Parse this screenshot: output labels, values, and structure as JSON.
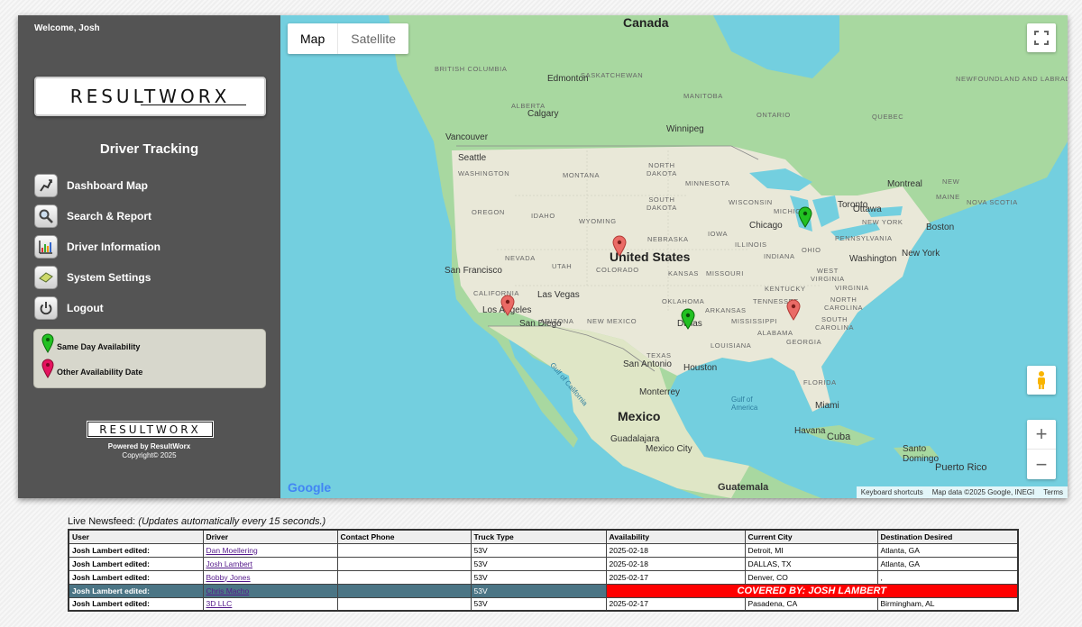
{
  "sidebar": {
    "welcome": "Welcome, Josh",
    "logo_text": "RESULTWORX",
    "section_title": "Driver Tracking",
    "nav": [
      {
        "label": "Dashboard Map",
        "icon": "map-route-icon"
      },
      {
        "label": "Search & Report",
        "icon": "magnifier-icon"
      },
      {
        "label": "Driver Information",
        "icon": "chart-icon"
      },
      {
        "label": "System Settings",
        "icon": "settings-icon"
      },
      {
        "label": "Logout",
        "icon": "power-icon"
      }
    ],
    "legend": {
      "same_day": "Same Day Availability",
      "other": "Other Availability Date",
      "same_day_color": "#22c122",
      "other_color": "#e5135f"
    },
    "footer_logo": "RESULTWORX",
    "powered_by": "Powered by ResultWorx",
    "copyright": "Copyright© 2025"
  },
  "map": {
    "type_map": "Map",
    "type_satellite": "Satellite",
    "attribution": {
      "shortcuts": "Keyboard shortcuts",
      "data": "Map data ©2025 Google, INEGI",
      "terms": "Terms"
    },
    "google": "Google",
    "labels": {
      "canada": "Canada",
      "united_states": "United States",
      "mexico": "Mexico",
      "british_columbia": "BRITISH\nCOLUMBIA",
      "alberta": "ALBERTA",
      "saskatchewan": "SASKATCHEWAN",
      "manitoba": "MANITOBA",
      "ontario": "ONTARIO",
      "quebec": "QUEBEC",
      "newfoundland": "NEWFOUNDLAND\nAND LABRADOR",
      "edmonton": "Edmonton",
      "calgary": "Calgary",
      "vancouver": "Vancouver",
      "seattle": "Seattle",
      "winnipeg": "Winnipeg",
      "washington_state": "WASHINGTON",
      "oregon": "OREGON",
      "idaho": "IDAHO",
      "montana": "MONTANA",
      "wyoming": "WYOMING",
      "north_dakota": "NORTH\nDAKOTA",
      "south_dakota": "SOUTH\nDAKOTA",
      "minnesota": "MINNESOTA",
      "wisconsin": "WISCONSIN",
      "michigan": "MICHIGAN",
      "nebraska": "NEBRASKA",
      "iowa": "IOWA",
      "illinois": "ILLINOIS",
      "indiana": "INDIANA",
      "ohio": "OHIO",
      "nevada": "NEVADA",
      "utah": "UTAH",
      "colorado": "COLORADO",
      "kansas": "KANSAS",
      "missouri": "MISSOURI",
      "kentucky": "KENTUCKY",
      "west_virginia": "WEST\nVIRGINIA",
      "virginia": "VIRGINIA",
      "pennsylvania": "PENNSYLVANIA",
      "new_york_state": "NEW YORK",
      "maine": "MAINE",
      "new_brunswick": "NEW",
      "nova_scotia": "NOVA SCOTIA",
      "california": "CALIFORNIA",
      "arizona": "ARIZONA",
      "new_mexico": "NEW MEXICO",
      "oklahoma": "OKLAHOMA",
      "arkansas": "ARKANSAS",
      "tennessee": "TENNESSEE",
      "north_carolina": "NORTH\nCAROLINA",
      "south_carolina": "SOUTH\nCAROLINA",
      "mississippi": "MISSISSIPPI",
      "alabama": "ALABAMA",
      "georgia": "GEORGIA",
      "texas": "TEXAS",
      "louisiana": "LOUISIANA",
      "florida": "FLORIDA",
      "ottawa": "Ottawa",
      "montreal": "Montreal",
      "toronto": "Toronto",
      "chicago": "Chicago",
      "boston": "Boston",
      "new_york": "New York",
      "washington": "Washington",
      "san_francisco": "San Francisco",
      "las_vegas": "Las Vegas",
      "los_angeles": "Los Angeles",
      "san_diego": "San Diego",
      "dallas": "Dallas",
      "houston": "Houston",
      "san_antonio": "San Antonio",
      "monterrey": "Monterrey",
      "guadalajara": "Guadalajara",
      "mexico_city": "Mexico City",
      "guatemala": "Guatemala",
      "havana": "Havana",
      "cuba": "Cuba",
      "miami": "Miami",
      "santo_domingo": "Santo\nDomingo",
      "puerto_rico": "Puerto Rico",
      "gulf_of_california": "Gulf of California",
      "gulf_of_america": "Gulf of\nAmerica"
    }
  },
  "feed": {
    "title": "Live Newsfeed:",
    "subtitle": "(Updates automatically every 15 seconds.)",
    "columns": [
      "User",
      "Driver",
      "Contact Phone",
      "Truck Type",
      "Availability",
      "Current City",
      "Destination Desired"
    ],
    "rows": [
      {
        "user": "Josh Lambert edited:",
        "driver": "Dan Moellering",
        "phone": "",
        "truck": "53V",
        "availability": "2025-02-18",
        "city": "Detroit, MI",
        "destination": "Atlanta, GA"
      },
      {
        "user": "Josh Lambert edited:",
        "driver": "Josh Lambert",
        "phone": "",
        "truck": "53V",
        "availability": "2025-02-18",
        "city": "DALLAS, TX",
        "destination": "Atlanta, GA"
      },
      {
        "user": "Josh Lambert edited:",
        "driver": "Bobby Jones",
        "phone": "",
        "truck": "53V",
        "availability": "2025-02-17",
        "city": "Denver, CO",
        "destination": ","
      },
      {
        "user": "Josh Lambert edited:",
        "driver": "Chris Macho",
        "phone": "",
        "truck": "53V",
        "covered": "COVERED BY: JOSH LAMBERT"
      },
      {
        "user": "Josh Lambert edited:",
        "driver": "3D LLC",
        "phone": "",
        "truck": "53V",
        "availability": "2025-02-17",
        "city": "Pasadena, CA",
        "destination": "Birmingham, AL"
      }
    ]
  }
}
